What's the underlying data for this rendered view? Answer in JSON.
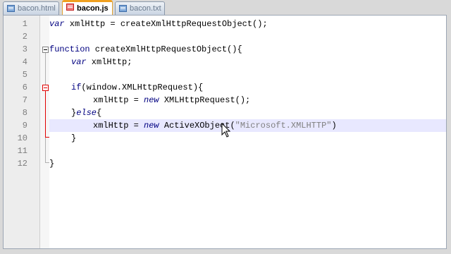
{
  "tabs": [
    {
      "label": "bacon.html",
      "icon": "file-html-icon",
      "active": false
    },
    {
      "label": "bacon.js",
      "icon": "file-js-icon",
      "active": true
    },
    {
      "label": "bacon.txt",
      "icon": "file-txt-icon",
      "active": false
    }
  ],
  "editor": {
    "line_numbers": [
      "1",
      "2",
      "3",
      "4",
      "5",
      "6",
      "7",
      "8",
      "9",
      "10",
      "11",
      "12"
    ],
    "lines": {
      "l1_kw": "var",
      "l1_rest": " xmlHttp = createXmlHttpRequestObject();",
      "l3_kw": "function",
      "l3_rest": " createXmlHttpRequestObject(){",
      "l4_kw": "var",
      "l4_rest": " xmlHttp;",
      "l6_kw": "if",
      "l6_rest": "(window.XMLHttpRequest){",
      "l7_a": "xmlHttp = ",
      "l7_kw": "new",
      "l7_b": " XMLHttpRequest();",
      "l8_a": "}",
      "l8_kw": "else",
      "l8_b": "{",
      "l9_a": "xmlHttp = ",
      "l9_kw": "new",
      "l9_b": " ActiveXObject(",
      "l9_str": "\"Microsoft.XMLHTTP\"",
      "l9_c": ")",
      "l10": "}",
      "l12": "}"
    }
  },
  "colors": {
    "keyword": "#000080",
    "string": "#808080",
    "active_tab_accent": "#f0a020",
    "current_line": "#e8e8ff"
  }
}
